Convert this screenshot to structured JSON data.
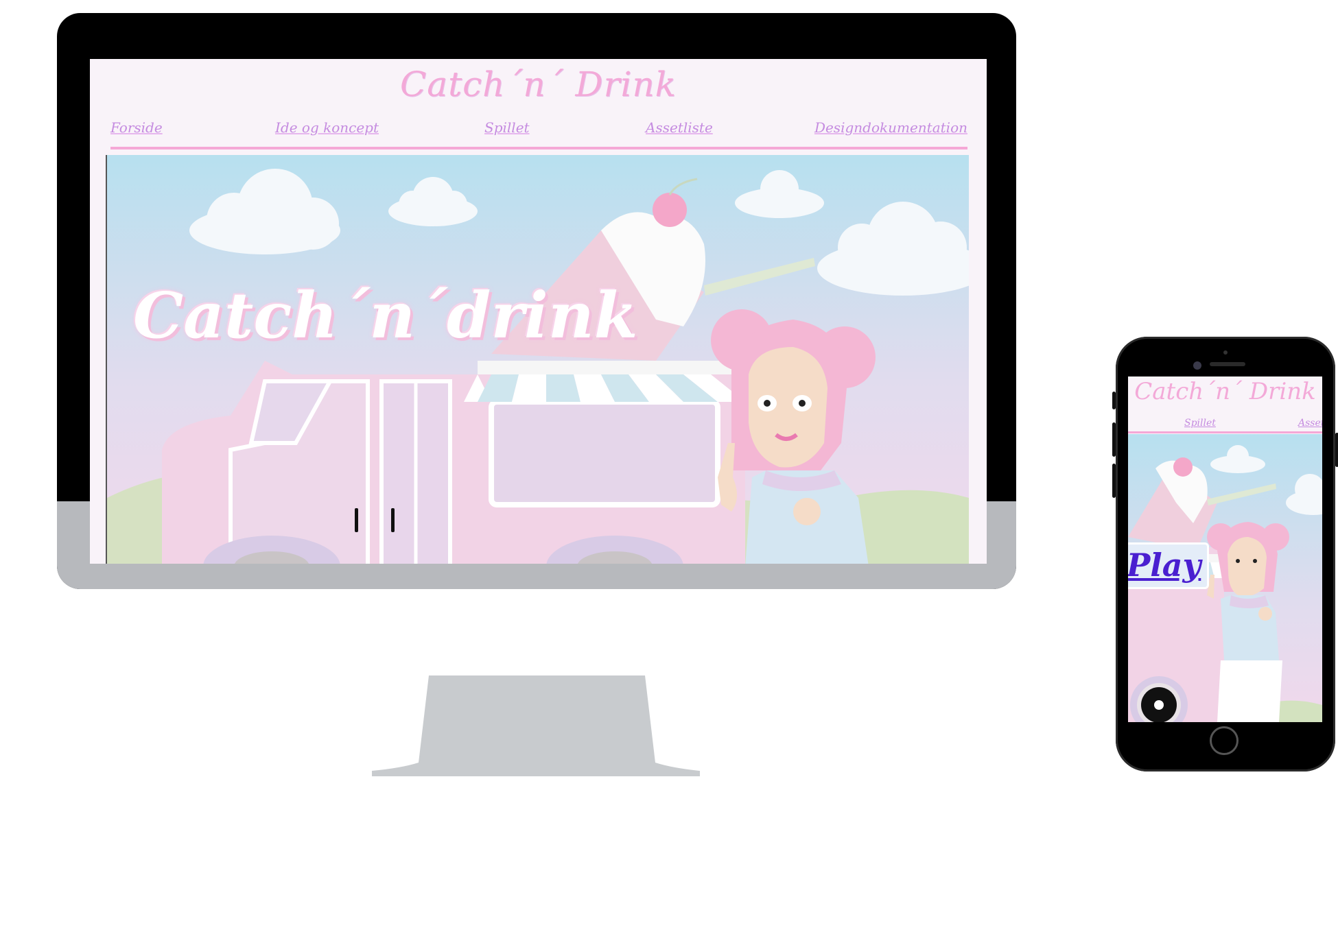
{
  "desktop": {
    "site_title": "Catch´n´ Drink",
    "nav": [
      "Forside",
      "Ide og koncept",
      "Spillet",
      "Assetliste",
      "Designdokumentation"
    ],
    "hero_title": "Catch´n´drink"
  },
  "phone": {
    "site_title": "Catch´n´ Drink",
    "nav": [
      "Spillet",
      "Asset"
    ],
    "play_label": "Play"
  },
  "colors": {
    "accent_pink": "#f3a9d8",
    "nav_purple": "#c58be0",
    "play_text": "#4a1fd0",
    "sky_top": "#b7e0ef",
    "sky_bottom": "#e8d6ee"
  }
}
